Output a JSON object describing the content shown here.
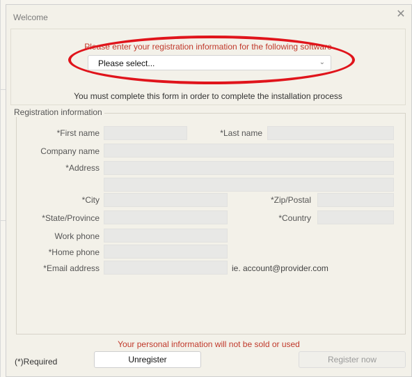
{
  "window": {
    "title": "Welcome"
  },
  "top": {
    "instruction": "Please enter your registration information for the following software",
    "software_select": {
      "value": "Please select..."
    },
    "notice": "You must complete this form in order to complete the installation process"
  },
  "registration": {
    "group_title": "Registration information",
    "fields": {
      "first_name": "*First name",
      "last_name": "*Last name",
      "company_name": "Company name",
      "address": "*Address",
      "city": "*City",
      "zip": "*Zip/Postal",
      "state": "*State/Province",
      "country": "*Country",
      "work_phone": "Work phone",
      "home_phone": "*Home phone",
      "email": "*Email address"
    },
    "email_hint": "ie. account@provider.com"
  },
  "footer": {
    "privacy_note": "Your personal information will not be sold or used",
    "required_note": "(*)Required",
    "unregister_label": "Unregister",
    "register_label": "Register now"
  },
  "colors": {
    "accent_red": "#c0392b",
    "highlight_ellipse": "#e0141b"
  }
}
